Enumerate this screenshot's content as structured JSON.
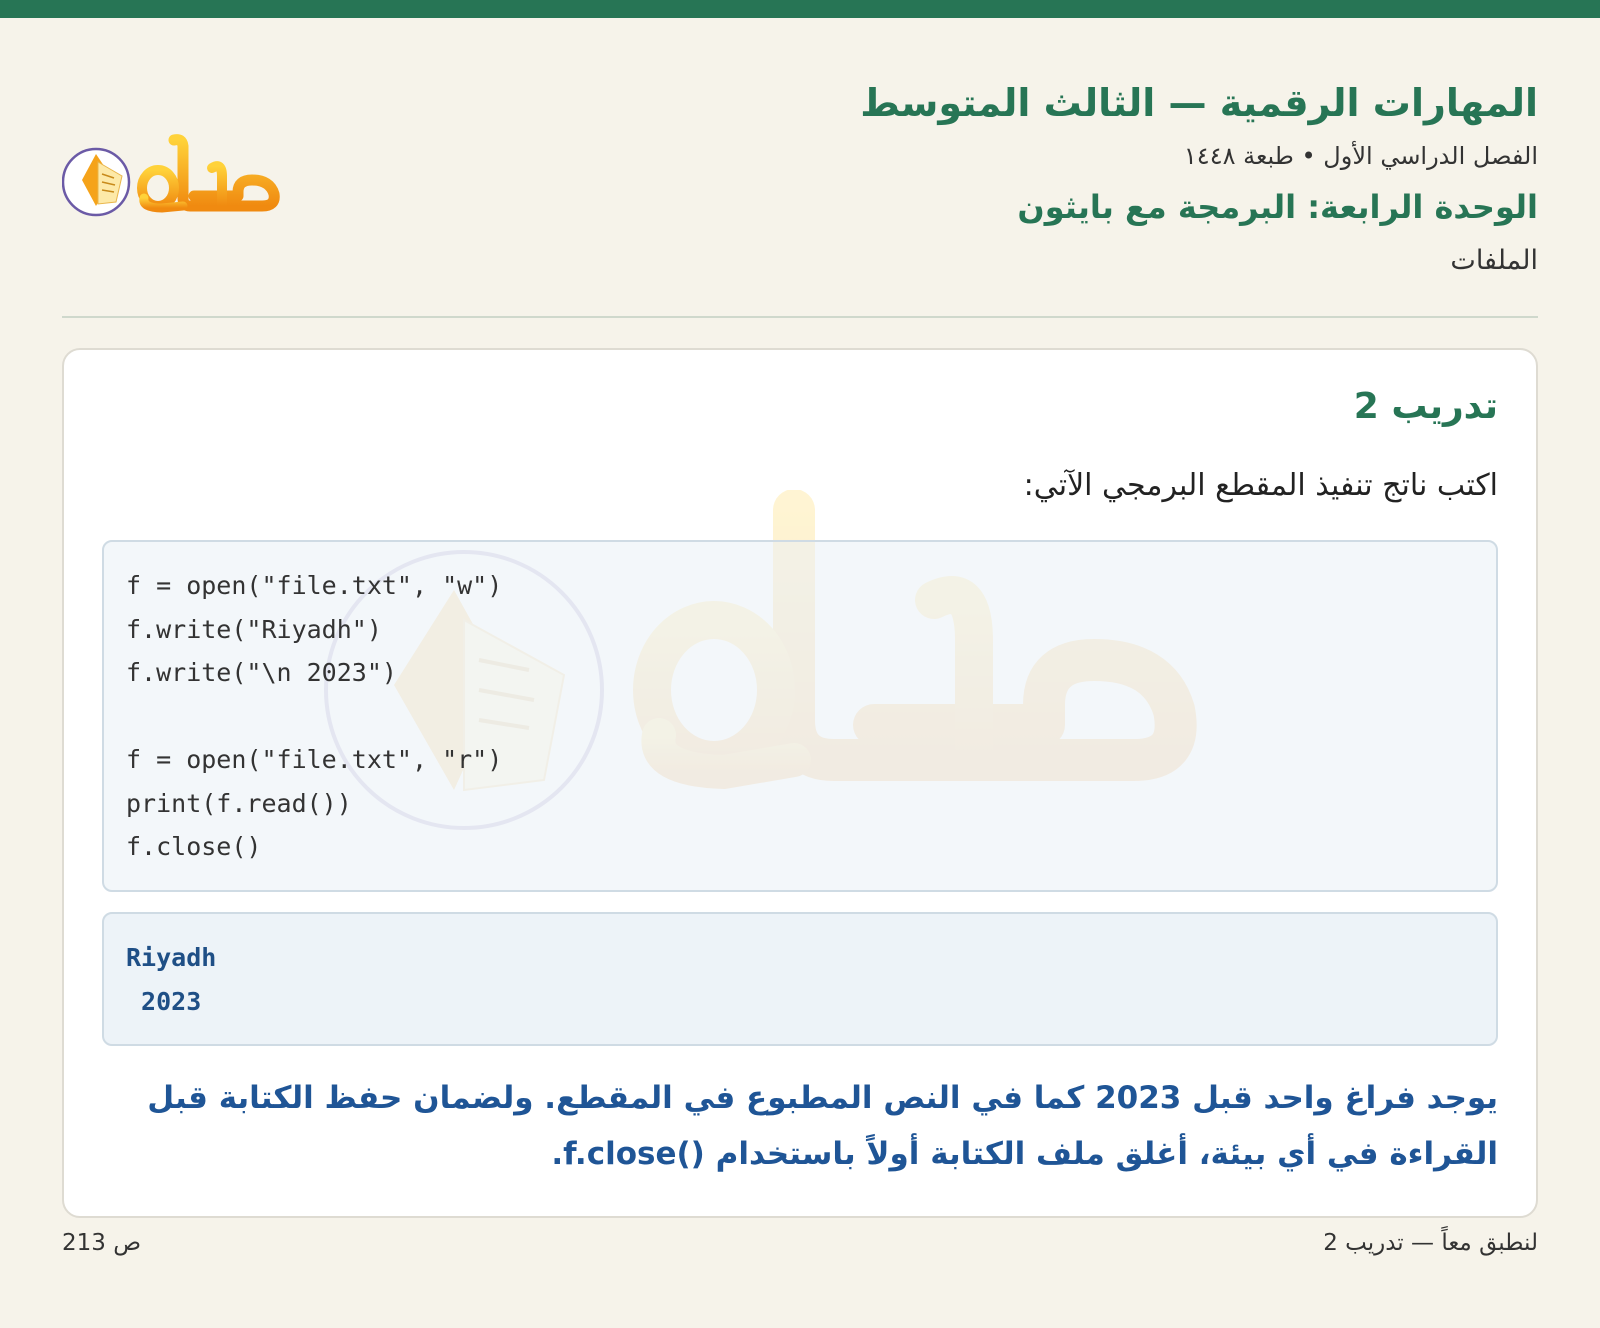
{
  "header": {
    "subject_title": "المهارات الرقمية — الثالث المتوسط",
    "term_line": "الفصل الدراسي الأول • طبعة ١٤٤٨",
    "unit_title": "الوحدة الرابعة: البرمجة مع بايثون",
    "lesson_name": "الملفات",
    "logo_text": "حلول"
  },
  "card": {
    "exercise_title": "تدريب 2",
    "prompt": "اكتب ناتج تنفيذ المقطع البرمجي الآتي:",
    "code_lines": [
      "f = open(\"file.txt\", \"w\")",
      "f.write(\"Riyadh\")",
      "f.write(\"\\n 2023\")",
      "",
      "f = open(\"file.txt\", \"r\")",
      "print(f.read())",
      "f.close()"
    ],
    "output_lines": [
      "Riyadh",
      " 2023"
    ],
    "explanation": "يوجد فراغ واحد قبل 2023 كما في النص المطبوع في المقطع. ولضمان حفظ الكتابة قبل القراءة في أي بيئة، أغلق ملف الكتابة أولاً باستخدام ()f.close."
  },
  "footer": {
    "page": "ص 213",
    "context": "لنطبق معاً — تدريب 2"
  },
  "colors": {
    "accent_green": "#277555",
    "answer_blue": "#1f5596",
    "logo_orange": "#f39a12",
    "logo_purple": "#6b5aa6"
  }
}
